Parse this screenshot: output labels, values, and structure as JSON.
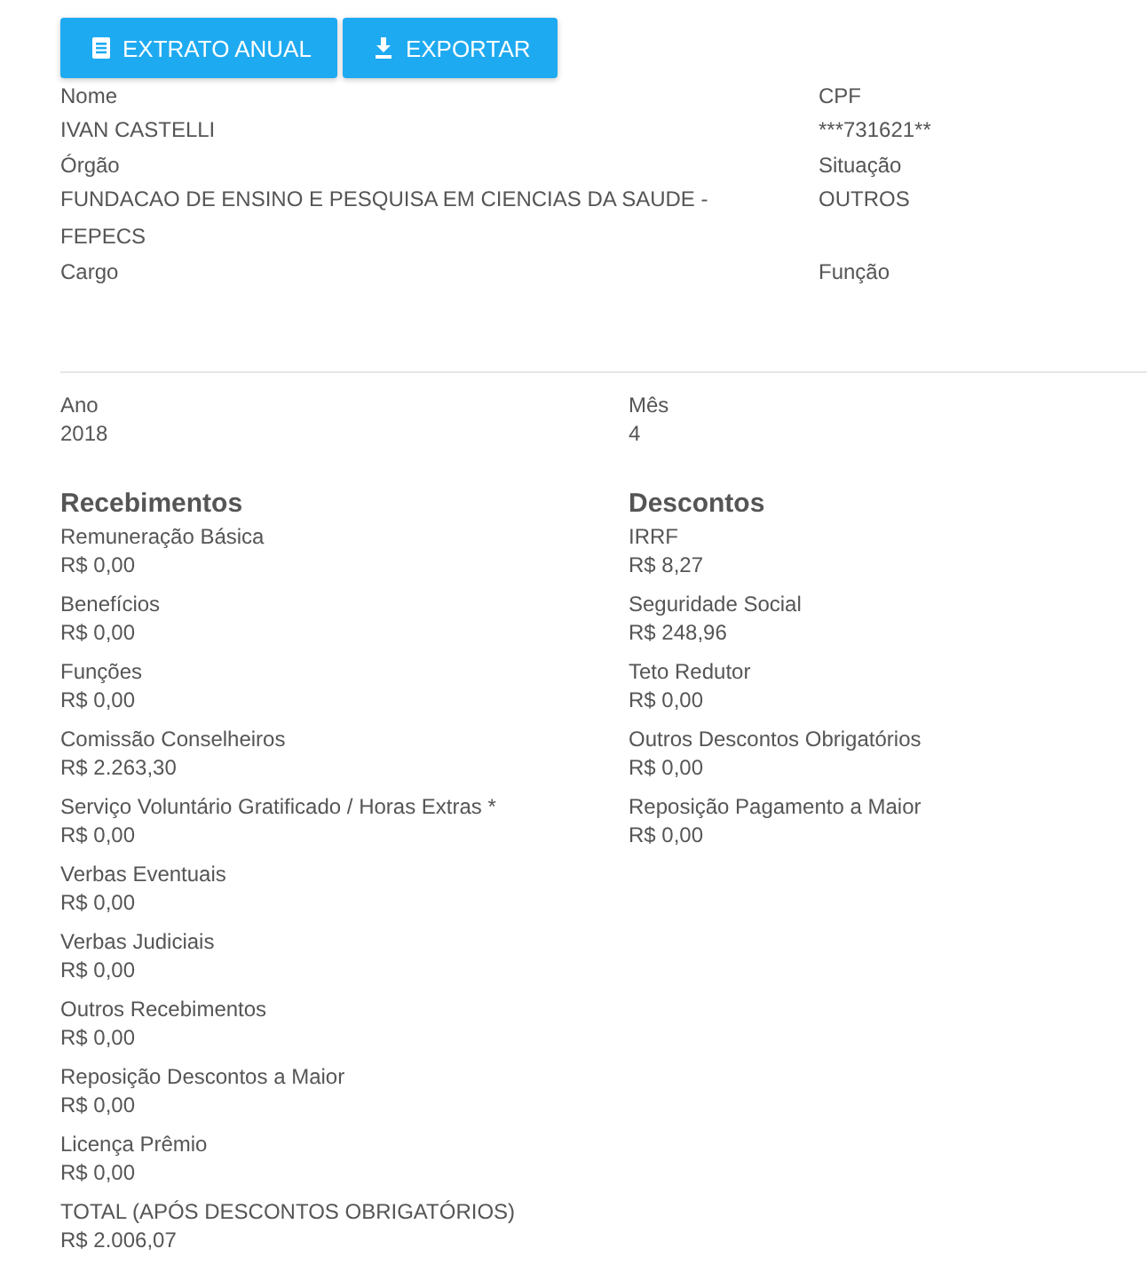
{
  "toolbar": {
    "buttons": [
      {
        "kind": "statement",
        "label": "EXTRATO ANUAL"
      },
      {
        "kind": "export",
        "label": "EXPORTAR"
      }
    ]
  },
  "employee": {
    "fields": [
      {
        "label": "Nome",
        "value": "IVAN CASTELLI"
      },
      {
        "label": "CPF",
        "value": "***731621**"
      },
      {
        "label": "Órgão",
        "value": "FUNDACAO DE ENSINO E PESQUISA EM CIENCIAS DA SAUDE - FEPECS"
      },
      {
        "label": "Situação",
        "value": "OUTROS"
      },
      {
        "label": "Cargo"
      },
      {
        "label": "Função"
      }
    ]
  },
  "period": {
    "fields": [
      {
        "label": "Ano",
        "value": "2018"
      },
      {
        "label": "Mês",
        "value": "4"
      }
    ]
  },
  "earnings": {
    "title": "Recebimentos",
    "items": [
      {
        "label": "Remuneração Básica",
        "value": "R$ 0,00"
      },
      {
        "label": "Benefícios",
        "value": "R$ 0,00"
      },
      {
        "label": "Funções",
        "value": "R$ 0,00"
      },
      {
        "label": "Comissão Conselheiros",
        "value": "R$ 2.263,30"
      },
      {
        "label": "Serviço Voluntário Gratificado / Horas Extras *",
        "value": "R$ 0,00"
      },
      {
        "label": "Verbas Eventuais",
        "value": "R$ 0,00"
      },
      {
        "label": "Verbas Judiciais",
        "value": "R$ 0,00"
      },
      {
        "label": "Outros Recebimentos",
        "value": "R$ 0,00"
      },
      {
        "label": "Reposição Descontos a Maior",
        "value": "R$ 0,00"
      },
      {
        "label": "Licença Prêmio",
        "value": "R$ 0,00"
      },
      {
        "label": "TOTAL (APÓS DESCONTOS OBRIGATÓRIOS)",
        "value": "R$ 2.006,07"
      }
    ]
  },
  "deductions": {
    "title": "Descontos",
    "items": [
      {
        "label": "IRRF",
        "value": "R$ 8,27"
      },
      {
        "label": "Seguridade Social",
        "value": "R$ 248,96"
      },
      {
        "label": "Teto Redutor",
        "value": "R$ 0,00"
      },
      {
        "label": "Outros Descontos Obrigatórios",
        "value": "R$ 0,00"
      },
      {
        "label": "Reposição Pagamento a Maior",
        "value": "R$ 0,00"
      }
    ]
  }
}
